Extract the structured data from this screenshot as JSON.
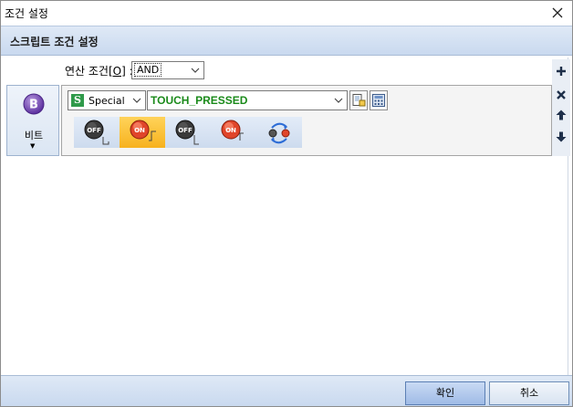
{
  "window": {
    "title": "조건 설정"
  },
  "header": {
    "title": "스크립트 조건 설정"
  },
  "operation": {
    "label_prefix": "연산 조건",
    "label_key": "[O]",
    "label_suffix": " :",
    "value": "AND"
  },
  "bit_panel": {
    "label": "비트",
    "arrow": "▼"
  },
  "condition": {
    "type_badge": "S",
    "type_value": "Special",
    "address_value": "TOUCH_PRESSED",
    "contacts": [
      {
        "id": "off-rising",
        "text": "OFF"
      },
      {
        "id": "on-rising",
        "text": "ON",
        "selected": true
      },
      {
        "id": "off-falling",
        "text": "OFF"
      },
      {
        "id": "on-falling",
        "text": "ON"
      },
      {
        "id": "change"
      }
    ]
  },
  "footer": {
    "ok_label": "확인",
    "cancel_label": "취소"
  }
}
